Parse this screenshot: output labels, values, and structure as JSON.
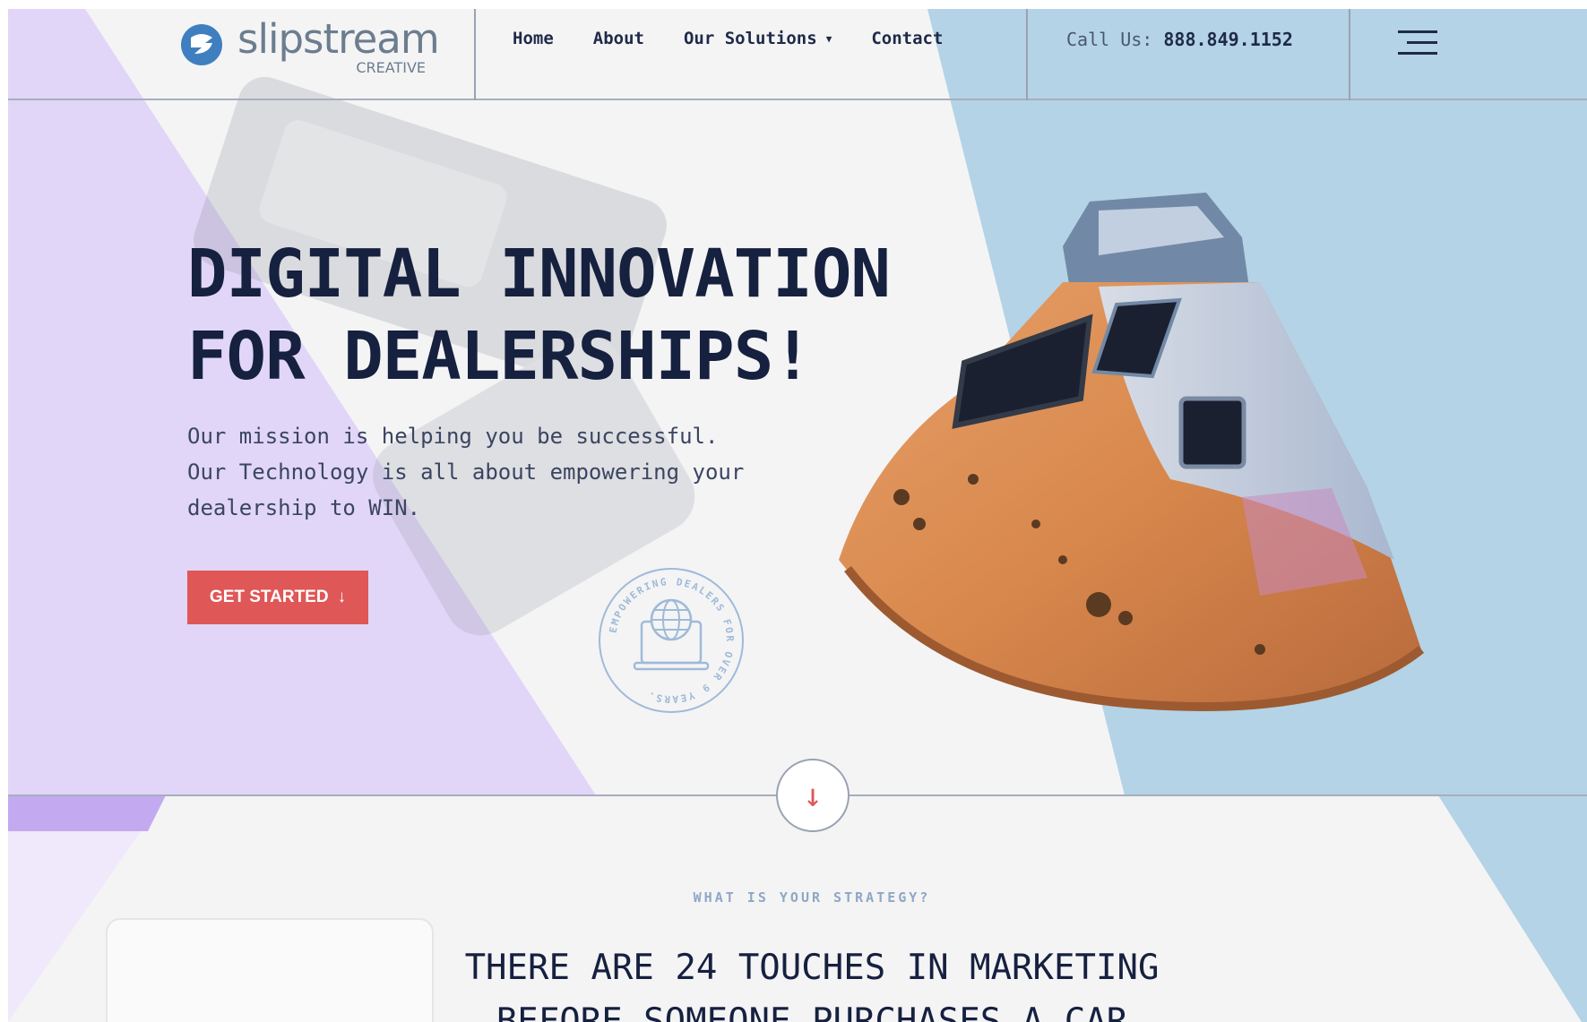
{
  "brand": {
    "name": "slipstream",
    "sub": "CREATIVE",
    "accent": "#3f7fbf"
  },
  "nav": {
    "items": [
      {
        "label": "Home"
      },
      {
        "label": "About"
      },
      {
        "label": "Our Solutions",
        "has_dropdown": true
      },
      {
        "label": "Contact"
      }
    ],
    "call_label": "Call Us:",
    "call_number": "888.849.1152",
    "menu_icon": "hamburger-icon"
  },
  "hero": {
    "title_line1": "DIGITAL INNOVATION",
    "title_line2": "FOR DEALERSHIPS!",
    "body_line1": "Our mission is helping you be successful.",
    "body_line2": "Our Technology is all about empowering your",
    "body_line3": "dealership to WIN.",
    "cta_label": "GET STARTED",
    "cta_icon": "arrow-down-icon",
    "badge_text": "EMPOWERING DEALERS FOR OVER 9 YEARS."
  },
  "scroll": {
    "icon": "arrow-down-icon"
  },
  "section": {
    "kicker": "WHAT IS YOUR STRATEGY?",
    "heading_line1": "THERE ARE 24 TOUCHES IN MARKETING",
    "heading_line2": "BEFORE SOMEONE PURCHASES A CAR"
  },
  "colors": {
    "lavender": "#e1d6f7",
    "sky": "#b4d3e6",
    "cta": "#e05757",
    "navy": "#16203f"
  }
}
